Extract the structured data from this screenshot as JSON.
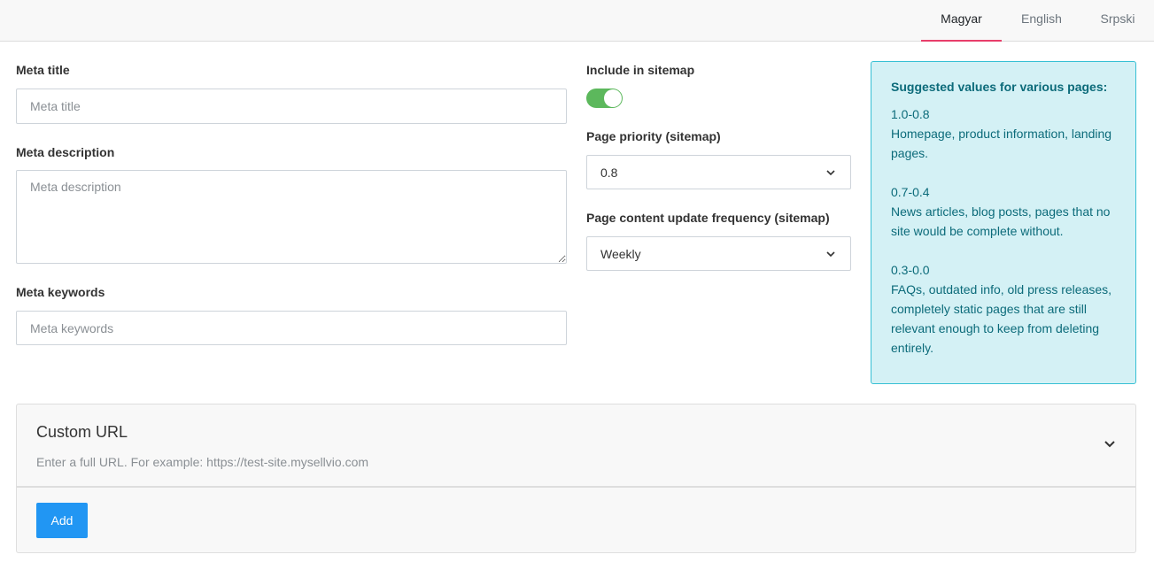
{
  "tabs": [
    {
      "label": "Magyar",
      "active": true
    },
    {
      "label": "English",
      "active": false
    },
    {
      "label": "Srpski",
      "active": false
    }
  ],
  "left_form": {
    "meta_title_label": "Meta title",
    "meta_title_placeholder": "Meta title",
    "meta_title_value": "",
    "meta_description_label": "Meta description",
    "meta_description_placeholder": "Meta description",
    "meta_description_value": "",
    "meta_keywords_label": "Meta keywords",
    "meta_keywords_placeholder": "Meta keywords",
    "meta_keywords_value": ""
  },
  "sitemap": {
    "include_label": "Include in sitemap",
    "include_enabled": true,
    "priority_label": "Page priority (sitemap)",
    "priority_value": "0.8",
    "frequency_label": "Page content update frequency (sitemap)",
    "frequency_value": "Weekly"
  },
  "suggestions": {
    "title": "Suggested values for various pages:",
    "blocks": [
      {
        "range": "1.0-0.8",
        "description": "Homepage, product information, landing pages."
      },
      {
        "range": "0.7-0.4",
        "description": "News articles, blog posts, pages that no site would be complete without."
      },
      {
        "range": "0.3-0.0",
        "description": "FAQs, outdated info, old press releases, completely static pages that are still relevant enough to keep from deleting entirely."
      }
    ]
  },
  "custom_url": {
    "title": "Custom URL",
    "subtitle": "Enter a full URL. For example: https://test-site.mysellvio.com",
    "add_label": "Add"
  },
  "colors": {
    "tab_active_underline": "#e83e6b",
    "toggle_on": "#5cb85c",
    "info_bg": "#d4f1f5",
    "info_border": "#37c0d4",
    "info_text": "#0c6b7a",
    "primary_button": "#2196f3"
  },
  "icons": {
    "select_chevron": "chevron-down-icon",
    "card_chevron": "chevron-down-icon"
  }
}
